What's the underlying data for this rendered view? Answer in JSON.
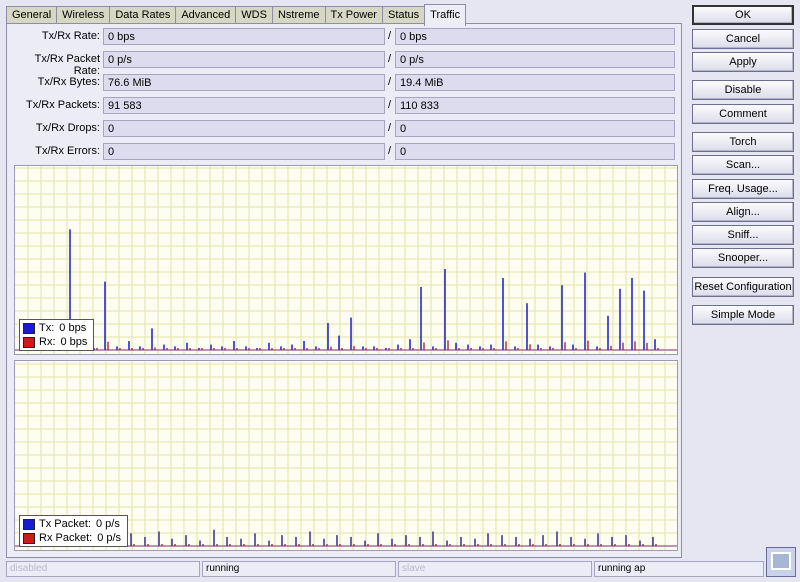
{
  "tabs": [
    "General",
    "Wireless",
    "Data Rates",
    "Advanced",
    "WDS",
    "Nstreme",
    "Tx Power",
    "Status",
    "Traffic"
  ],
  "active_tab": "Traffic",
  "stats": [
    {
      "label": "Tx/Rx Rate:",
      "tx": "0 bps",
      "rx": "0 bps"
    },
    {
      "label": "Tx/Rx Packet Rate:",
      "tx": "0 p/s",
      "rx": "0 p/s"
    },
    {
      "label": "Tx/Rx Bytes:",
      "tx": "76.6 MiB",
      "rx": "19.4 MiB"
    },
    {
      "label": "Tx/Rx Packets:",
      "tx": "91 583",
      "rx": "110 833"
    },
    {
      "label": "Tx/Rx Drops:",
      "tx": "0",
      "rx": "0"
    },
    {
      "label": "Tx/Rx Errors:",
      "tx": "0",
      "rx": "0"
    }
  ],
  "separator": "/",
  "charts": {
    "rate": {
      "legend": [
        {
          "name": "Tx:",
          "value": "0 bps",
          "color": "#1a1ad0"
        },
        {
          "name": "Rx:",
          "value": "0 bps",
          "color": "#d01a1a"
        }
      ]
    },
    "packets": {
      "legend": [
        {
          "name": "Tx Packet:",
          "value": "0 p/s",
          "color": "#1a1ad0"
        },
        {
          "name": "Rx Packet:",
          "value": "0 p/s",
          "color": "#d01a1a"
        }
      ]
    }
  },
  "chart_data": [
    {
      "type": "bar",
      "series": [
        {
          "values": [
            0.03,
            0.01,
            0.02,
            0.67,
            0.02,
            0.01,
            0.38,
            0.02,
            0.05,
            0.02,
            0.12,
            0.03,
            0.02,
            0.04,
            0.01,
            0.03,
            0.02,
            0.05,
            0.02,
            0.01,
            0.04,
            0.02,
            0.03,
            0.05,
            0.02,
            0.15,
            0.08,
            0.18,
            0.02,
            0.02,
            0.01,
            0.03,
            0.06,
            0.35,
            0.02,
            0.45,
            0.04,
            0.03,
            0.02,
            0.03,
            0.4,
            0.02,
            0.26,
            0.03,
            0.02,
            0.36,
            0.03,
            0.43,
            0.02,
            0.19,
            0.34,
            0.4,
            0.33,
            0.06
          ]
        }
      ]
    },
    {
      "type": "bar",
      "series": [
        {
          "values": [
            0.02,
            0.04,
            0.03,
            0.06,
            0.03,
            0.05,
            0.04,
            0.07,
            0.05,
            0.08,
            0.04,
            0.06,
            0.03,
            0.09,
            0.05,
            0.04,
            0.07,
            0.03,
            0.06,
            0.05,
            0.08,
            0.04,
            0.06,
            0.05,
            0.03,
            0.07,
            0.04,
            0.06,
            0.05,
            0.08,
            0.03,
            0.05,
            0.04,
            0.07,
            0.06,
            0.05,
            0.04,
            0.06,
            0.08,
            0.05,
            0.04,
            0.07,
            0.05,
            0.06,
            0.03,
            0.05
          ]
        }
      ]
    }
  ],
  "buttons": [
    "OK",
    "Cancel",
    "Apply",
    "Disable",
    "Comment",
    "Torch",
    "Scan...",
    "Freq. Usage...",
    "Align...",
    "Sniff...",
    "Snooper...",
    "Reset Configuration",
    "Simple Mode"
  ],
  "status": [
    "disabled",
    "running",
    "slave",
    "running ap"
  ]
}
